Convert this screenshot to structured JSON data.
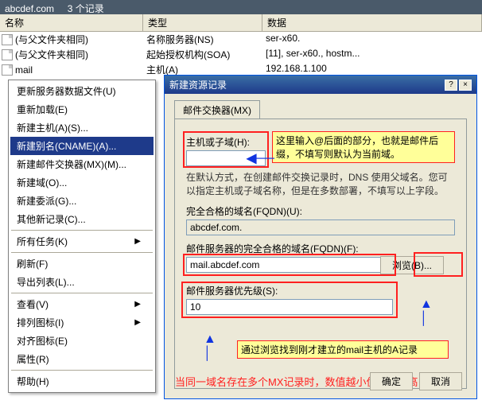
{
  "titlebar": {
    "domain": "abcdef.com",
    "records": "3 个记录"
  },
  "columns": {
    "name": "名称",
    "type": "类型",
    "data": "数据"
  },
  "rows": [
    {
      "name": "(与父文件夹相同)",
      "type": "名称服务器(NS)",
      "data": "ser-x60."
    },
    {
      "name": "(与父文件夹相同)",
      "type": "起始授权机构(SOA)",
      "data": "[11], ser-x60., hostm..."
    },
    {
      "name": "mail",
      "type": "主机(A)",
      "data": "192.168.1.100"
    }
  ],
  "menu": {
    "items1": [
      "更新服务器数据文件(U)",
      "重新加载(E)",
      "新建主机(A)(S)...",
      "新建别名(CNAME)(A)...",
      "新建邮件交换器(MX)(M)...",
      "新建域(O)...",
      "新建委派(G)...",
      "其他新记录(C)..."
    ],
    "highlight_index": 3,
    "all_tasks": "所有任务(K)",
    "items2": [
      "刷新(F)",
      "导出列表(L)..."
    ],
    "items3": [
      "查看(V)",
      "排列图标(I)",
      "对齐图标(E)",
      "属性(R)"
    ],
    "help": "帮助(H)"
  },
  "dialog": {
    "title": "新建资源记录",
    "tab": "邮件交换器(MX)",
    "host_label": "主机或子域(H):",
    "host_value": "",
    "help1": "在默认方式，在创建邮件交换记录时，DNS 使用父域名。您可以指定主机或子域名称，但是在多数部署，不填写以上字段。",
    "fqdn_label": "完全合格的域名(FQDN)(U):",
    "fqdn_value": "abcdef.com.",
    "mailfqdn_label": "邮件服务器的完全合格的域名(FQDN)(F):",
    "mailfqdn_value": "mail.abcdef.com",
    "browse": "浏览(B)...",
    "priority_label": "邮件服务器优先级(S):",
    "priority_value": "10",
    "callout1": "这里输入@后面的部分，也就是邮件后缀，不填写则默认为当前域。",
    "callout2": "通过浏览找到刚才建立的mail主机的A记录",
    "bottom_text": "当同一域名存在多个MX记录时，数值越小优先级越高",
    "ok": "确定",
    "cancel": "取消"
  }
}
